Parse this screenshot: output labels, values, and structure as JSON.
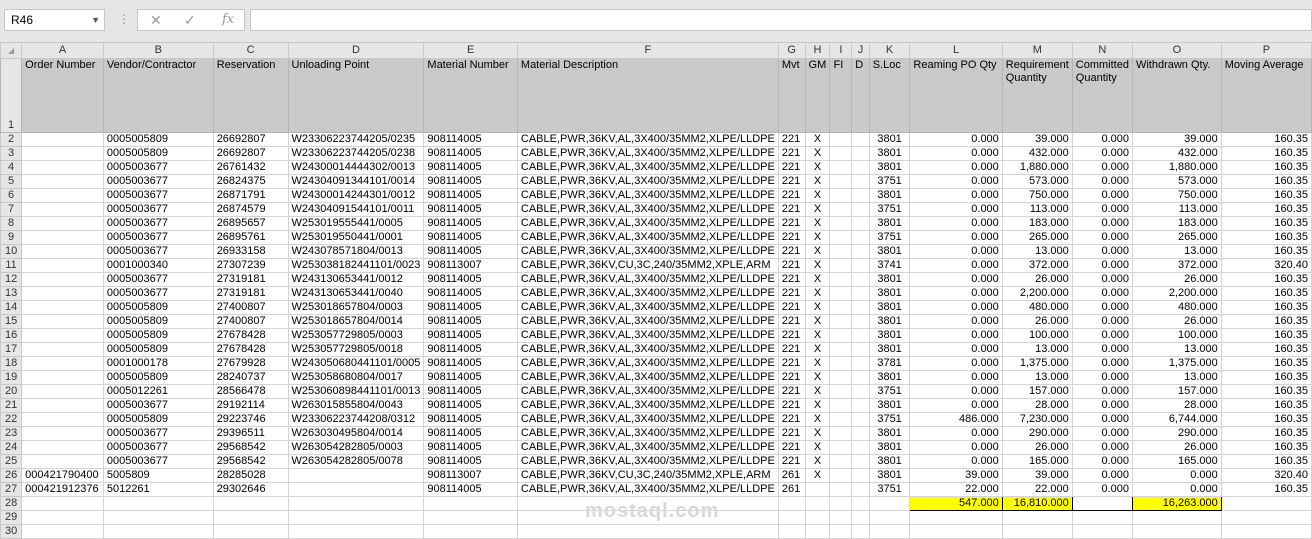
{
  "name_box": "R46",
  "formula": "",
  "columns": [
    "A",
    "B",
    "C",
    "D",
    "E",
    "F",
    "G",
    "H",
    "I",
    "J",
    "K",
    "L",
    "M",
    "N",
    "O",
    "P"
  ],
  "headers": [
    "Order Number",
    "Vendor/Contractor",
    "Reservation",
    "Unloading Point",
    "Material Number",
    "Material Description",
    "Mvt",
    "GM",
    "FI",
    "D",
    "S.Loc",
    "Reaming  PO Qty",
    "Requirement Quantity",
    "Committed Quantity",
    "Withdrawn Qty.",
    "Moving Average"
  ],
  "rows": [
    [
      "",
      "0005005809",
      "26692807",
      "W23306223744205/0235",
      "908114005",
      "CABLE,PWR,36KV,AL,3X400/35MM2,XLPE/LLDPE",
      "221",
      "X",
      "",
      "",
      "3801",
      "0.000",
      "39.000",
      "0.000",
      "39.000",
      "160.35"
    ],
    [
      "",
      "0005005809",
      "26692807",
      "W23306223744205/0238",
      "908114005",
      "CABLE,PWR,36KV,AL,3X400/35MM2,XLPE/LLDPE",
      "221",
      "X",
      "",
      "",
      "3801",
      "0.000",
      "432.000",
      "0.000",
      "432.000",
      "160.35"
    ],
    [
      "",
      "0005003677",
      "26761432",
      "W24300014444302/0013",
      "908114005",
      "CABLE,PWR,36KV,AL,3X400/35MM2,XLPE/LLDPE",
      "221",
      "X",
      "",
      "",
      "3801",
      "0.000",
      "1,880.000",
      "0.000",
      "1,880.000",
      "160.35"
    ],
    [
      "",
      "0005003677",
      "26824375",
      "W24304091344101/0014",
      "908114005",
      "CABLE,PWR,36KV,AL,3X400/35MM2,XLPE/LLDPE",
      "221",
      "X",
      "",
      "",
      "3751",
      "0.000",
      "573.000",
      "0.000",
      "573.000",
      "160.35"
    ],
    [
      "",
      "0005003677",
      "26871791",
      "W24300014244301/0012",
      "908114005",
      "CABLE,PWR,36KV,AL,3X400/35MM2,XLPE/LLDPE",
      "221",
      "X",
      "",
      "",
      "3801",
      "0.000",
      "750.000",
      "0.000",
      "750.000",
      "160.35"
    ],
    [
      "",
      "0005003677",
      "26874579",
      "W24304091544101/0011",
      "908114005",
      "CABLE,PWR,36KV,AL,3X400/35MM2,XLPE/LLDPE",
      "221",
      "X",
      "",
      "",
      "3751",
      "0.000",
      "113.000",
      "0.000",
      "113.000",
      "160.35"
    ],
    [
      "",
      "0005003677",
      "26895657",
      "W253019555441/0005",
      "908114005",
      "CABLE,PWR,36KV,AL,3X400/35MM2,XLPE/LLDPE",
      "221",
      "X",
      "",
      "",
      "3801",
      "0.000",
      "183.000",
      "0.000",
      "183.000",
      "160.35"
    ],
    [
      "",
      "0005003677",
      "26895761",
      "W253019550441/0001",
      "908114005",
      "CABLE,PWR,36KV,AL,3X400/35MM2,XLPE/LLDPE",
      "221",
      "X",
      "",
      "",
      "3751",
      "0.000",
      "265.000",
      "0.000",
      "265.000",
      "160.35"
    ],
    [
      "",
      "0005003677",
      "26933158",
      "W243078571804/0013",
      "908114005",
      "CABLE,PWR,36KV,AL,3X400/35MM2,XLPE/LLDPE",
      "221",
      "X",
      "",
      "",
      "3801",
      "0.000",
      "13.000",
      "0.000",
      "13.000",
      "160.35"
    ],
    [
      "",
      "0001000340",
      "27307239",
      "W253038182441101/0023",
      "908113007",
      "CABLE,PWR,36KV,CU,3C,240/35MM2,XPLE,ARM",
      "221",
      "X",
      "",
      "",
      "3741",
      "0.000",
      "372.000",
      "0.000",
      "372.000",
      "320.40"
    ],
    [
      "",
      "0005003677",
      "27319181",
      "W243130653441/0012",
      "908114005",
      "CABLE,PWR,36KV,AL,3X400/35MM2,XLPE/LLDPE",
      "221",
      "X",
      "",
      "",
      "3801",
      "0.000",
      "26.000",
      "0.000",
      "26.000",
      "160.35"
    ],
    [
      "",
      "0005003677",
      "27319181",
      "W243130653441/0040",
      "908114005",
      "CABLE,PWR,36KV,AL,3X400/35MM2,XLPE/LLDPE",
      "221",
      "X",
      "",
      "",
      "3801",
      "0.000",
      "2,200.000",
      "0.000",
      "2,200.000",
      "160.35"
    ],
    [
      "",
      "0005005809",
      "27400807",
      "W253018657804/0003",
      "908114005",
      "CABLE,PWR,36KV,AL,3X400/35MM2,XLPE/LLDPE",
      "221",
      "X",
      "",
      "",
      "3801",
      "0.000",
      "480.000",
      "0.000",
      "480.000",
      "160.35"
    ],
    [
      "",
      "0005005809",
      "27400807",
      "W253018657804/0014",
      "908114005",
      "CABLE,PWR,36KV,AL,3X400/35MM2,XLPE/LLDPE",
      "221",
      "X",
      "",
      "",
      "3801",
      "0.000",
      "26.000",
      "0.000",
      "26.000",
      "160.35"
    ],
    [
      "",
      "0005005809",
      "27678428",
      "W253057729805/0003",
      "908114005",
      "CABLE,PWR,36KV,AL,3X400/35MM2,XLPE/LLDPE",
      "221",
      "X",
      "",
      "",
      "3801",
      "0.000",
      "100.000",
      "0.000",
      "100.000",
      "160.35"
    ],
    [
      "",
      "0005005809",
      "27678428",
      "W253057729805/0018",
      "908114005",
      "CABLE,PWR,36KV,AL,3X400/35MM2,XLPE/LLDPE",
      "221",
      "X",
      "",
      "",
      "3801",
      "0.000",
      "13.000",
      "0.000",
      "13.000",
      "160.35"
    ],
    [
      "",
      "0001000178",
      "27679928",
      "W243050680441101/0005",
      "908114005",
      "CABLE,PWR,36KV,AL,3X400/35MM2,XLPE/LLDPE",
      "221",
      "X",
      "",
      "",
      "3781",
      "0.000",
      "1,375.000",
      "0.000",
      "1,375.000",
      "160.35"
    ],
    [
      "",
      "0005005809",
      "28240737",
      "W253058680804/0017",
      "908114005",
      "CABLE,PWR,36KV,AL,3X400/35MM2,XLPE/LLDPE",
      "221",
      "X",
      "",
      "",
      "3801",
      "0.000",
      "13.000",
      "0.000",
      "13.000",
      "160.35"
    ],
    [
      "",
      "0005012261",
      "28566478",
      "W253060898441101/0013",
      "908114005",
      "CABLE,PWR,36KV,AL,3X400/35MM2,XLPE/LLDPE",
      "221",
      "X",
      "",
      "",
      "3751",
      "0.000",
      "157.000",
      "0.000",
      "157.000",
      "160.35"
    ],
    [
      "",
      "0005003677",
      "29192114",
      "W263015855804/0043",
      "908114005",
      "CABLE,PWR,36KV,AL,3X400/35MM2,XLPE/LLDPE",
      "221",
      "X",
      "",
      "",
      "3801",
      "0.000",
      "28.000",
      "0.000",
      "28.000",
      "160.35"
    ],
    [
      "",
      "0005005809",
      "29223746",
      "W23306223744208/0312",
      "908114005",
      "CABLE,PWR,36KV,AL,3X400/35MM2,XLPE/LLDPE",
      "221",
      "X",
      "",
      "",
      "3751",
      "486.000",
      "7,230.000",
      "0.000",
      "6,744.000",
      "160.35"
    ],
    [
      "",
      "0005003677",
      "29396511",
      "W263030495804/0014",
      "908114005",
      "CABLE,PWR,36KV,AL,3X400/35MM2,XLPE/LLDPE",
      "221",
      "X",
      "",
      "",
      "3801",
      "0.000",
      "290.000",
      "0.000",
      "290.000",
      "160.35"
    ],
    [
      "",
      "0005003677",
      "29568542",
      "W263054282805/0003",
      "908114005",
      "CABLE,PWR,36KV,AL,3X400/35MM2,XLPE/LLDPE",
      "221",
      "X",
      "",
      "",
      "3801",
      "0.000",
      "26.000",
      "0.000",
      "26.000",
      "160.35"
    ],
    [
      "",
      "0005003677",
      "29568542",
      "W263054282805/0078",
      "908114005",
      "CABLE,PWR,36KV,AL,3X400/35MM2,XLPE/LLDPE",
      "221",
      "X",
      "",
      "",
      "3801",
      "0.000",
      "165.000",
      "0.000",
      "165.000",
      "160.35"
    ],
    [
      "000421790400",
      "5005809",
      "28285028",
      "",
      "908113007",
      "CABLE,PWR,36KV,CU,3C,240/35MM2,XPLE,ARM",
      "261",
      "X",
      "",
      "",
      "3801",
      "39.000",
      "39.000",
      "0.000",
      "0.000",
      "320.40"
    ],
    [
      "000421912376",
      "5012261",
      "29302646",
      "",
      "908114005",
      "CABLE,PWR,36KV,AL,3X400/35MM2,XLPE/LLDPE",
      "261",
      "",
      "",
      "",
      "3751",
      "22.000",
      "22.000",
      "0.000",
      "0.000",
      "160.35"
    ]
  ],
  "totals": {
    "reaming_po": "547.000",
    "requirement": "16,810.000",
    "withdrawn": "16,263.000"
  },
  "watermark": "mostaql.com"
}
